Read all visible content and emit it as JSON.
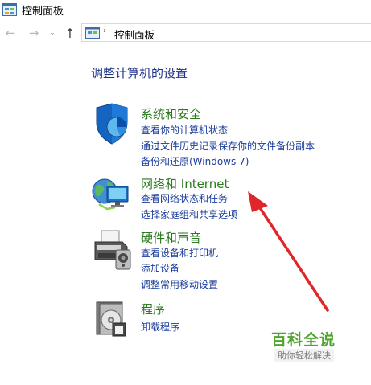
{
  "window": {
    "title": "控制面板"
  },
  "navbar": {
    "back_icon": "←",
    "forward_icon": "→",
    "recent_icon": "⌄",
    "up_icon": "↑",
    "separator": "›",
    "address": "控制面板"
  },
  "main": {
    "heading": "调整计算机的设置",
    "sections": [
      {
        "title": "系统和安全",
        "icon": "shield-icon",
        "links": [
          "查看你的计算机状态",
          "通过文件历史记录保存你的文件备份副本",
          "备份和还原(Windows 7)"
        ]
      },
      {
        "title": "网络和 Internet",
        "icon": "network-globe-icon",
        "links": [
          "查看网络状态和任务",
          "选择家庭组和共享选项"
        ]
      },
      {
        "title": "硬件和声音",
        "icon": "printer-icon",
        "links": [
          "查看设备和打印机",
          "添加设备",
          "调整常用移动设置"
        ]
      },
      {
        "title": "程序",
        "icon": "programs-disc-icon",
        "links": [
          "卸载程序"
        ]
      }
    ]
  },
  "watermark": {
    "title": "百科全说",
    "subtitle": "助你轻松解决"
  },
  "colors": {
    "heading": "#1e3287",
    "section_title": "#2b7a1f",
    "link": "#1a3c9b",
    "arrow": "#e0262a"
  }
}
